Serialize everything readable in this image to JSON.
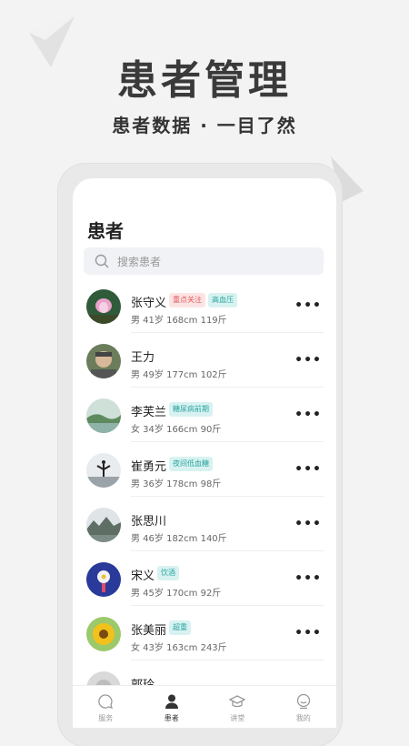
{
  "hero": {
    "title": "患者管理",
    "subtitle": "患者数据 · 一目了然"
  },
  "page": {
    "title": "患者",
    "search_placeholder": "搜索患者"
  },
  "patients": [
    {
      "name": "张守义",
      "info": "男 41岁 168cm 119斤",
      "tags": [
        {
          "text": "重点关注",
          "style": "red"
        },
        {
          "text": "高血压",
          "style": "teal"
        }
      ]
    },
    {
      "name": "王力",
      "info": "男 49岁 177cm 102斤",
      "tags": []
    },
    {
      "name": "李芙兰",
      "info": "女 34岁 166cm 90斤",
      "tags": [
        {
          "text": "糖尿病前期",
          "style": "teal"
        }
      ]
    },
    {
      "name": "崔勇元",
      "info": "男 36岁 178cm 98斤",
      "tags": [
        {
          "text": "夜间低血糖",
          "style": "teal"
        }
      ]
    },
    {
      "name": "张思川",
      "info": "男 46岁 182cm 140斤",
      "tags": []
    },
    {
      "name": "宋义",
      "info": "男 45岁 170cm 92斤",
      "tags": [
        {
          "text": "饮酒",
          "style": "teal"
        }
      ]
    },
    {
      "name": "张美丽",
      "info": "女 43岁 163cm 243斤",
      "tags": [
        {
          "text": "超重",
          "style": "teal"
        }
      ]
    },
    {
      "name": "郭玲",
      "info": "",
      "tags": []
    }
  ],
  "more_glyph": "•••",
  "tabs": [
    {
      "label": "服务",
      "icon": "chat-bubble-icon",
      "active": false
    },
    {
      "label": "患者",
      "icon": "person-icon",
      "active": true
    },
    {
      "label": "讲堂",
      "icon": "graduation-cap-icon",
      "active": false
    },
    {
      "label": "我的",
      "icon": "smiley-icon",
      "active": false
    }
  ],
  "colors": {
    "tag_red_bg": "#fde4e4",
    "tag_red_text": "#e05a5a",
    "tag_teal_bg": "#d8f2f1",
    "tag_teal_text": "#2aa5a0",
    "background": "#f3f3f3"
  }
}
